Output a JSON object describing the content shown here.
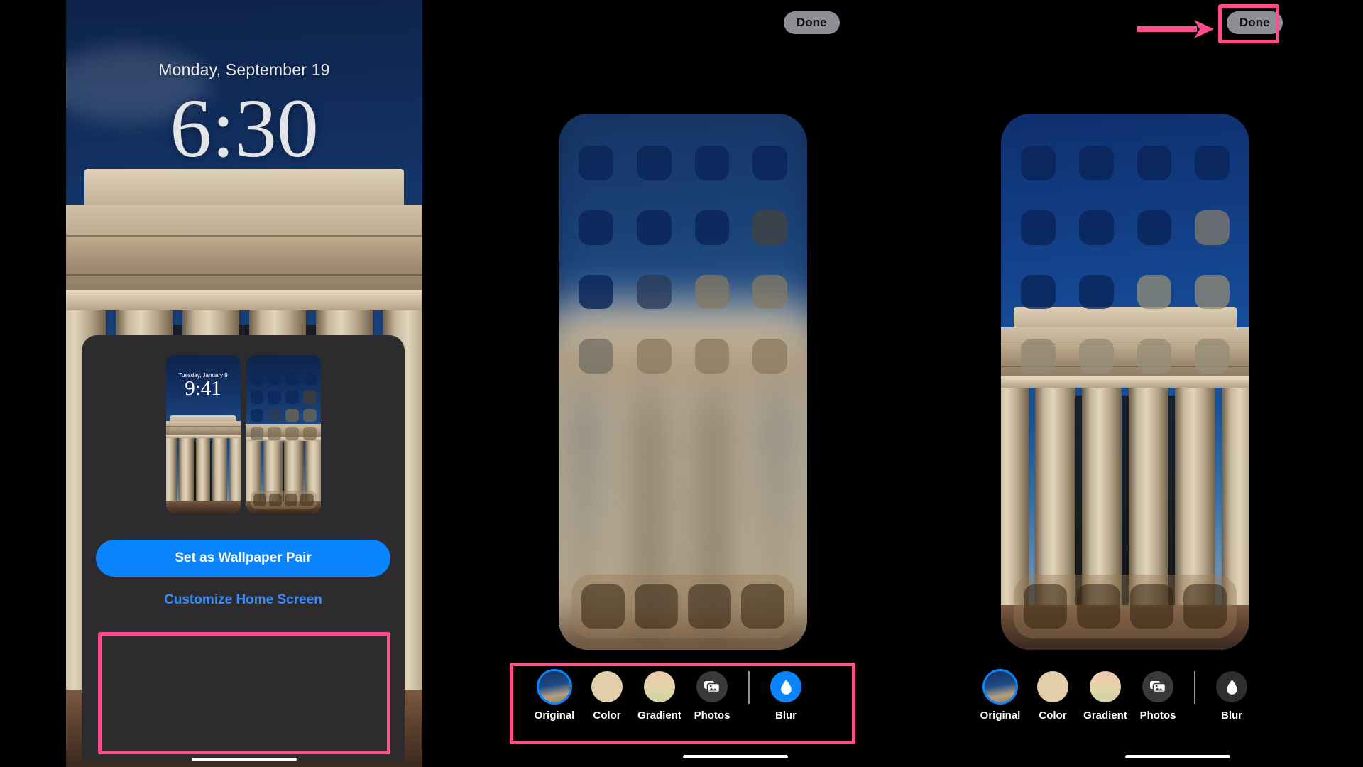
{
  "lock_screen": {
    "date": "Monday, September 19",
    "time": "6:30",
    "sheet": {
      "preview_lock": {
        "date": "Tuesday, January 9",
        "time": "9:41"
      },
      "set_pair_label": "Set as Wallpaper Pair",
      "customize_label": "Customize Home Screen"
    }
  },
  "center_editor": {
    "done_label": "Done",
    "blur_active": true,
    "options": [
      {
        "label": "Original",
        "icon": "wallpaper-thumbnail-icon",
        "selected": true
      },
      {
        "label": "Color",
        "icon": "color-swatch-icon",
        "selected": false
      },
      {
        "label": "Gradient",
        "icon": "gradient-swatch-icon",
        "selected": false
      },
      {
        "label": "Photos",
        "icon": "photos-icon",
        "selected": false
      },
      {
        "label": "Blur",
        "icon": "water-drop-icon",
        "selected": false
      }
    ]
  },
  "right_editor": {
    "done_label": "Done",
    "blur_active": false,
    "options": [
      {
        "label": "Original",
        "icon": "wallpaper-thumbnail-icon",
        "selected": true
      },
      {
        "label": "Color",
        "icon": "color-swatch-icon",
        "selected": false
      },
      {
        "label": "Gradient",
        "icon": "gradient-swatch-icon",
        "selected": false
      },
      {
        "label": "Photos",
        "icon": "photos-icon",
        "selected": false
      },
      {
        "label": "Blur",
        "icon": "water-drop-icon",
        "selected": false
      }
    ]
  },
  "annotations": {
    "highlight_color": "#ff4d8d",
    "arrow_target": "Done"
  },
  "colors": {
    "accent_blue": "#0a84ff",
    "link_blue": "#3d8bf7",
    "sheet_bg": "#2c2c2e",
    "done_bg": "#8e8e93",
    "highlight_pink": "#ff4d8d"
  }
}
